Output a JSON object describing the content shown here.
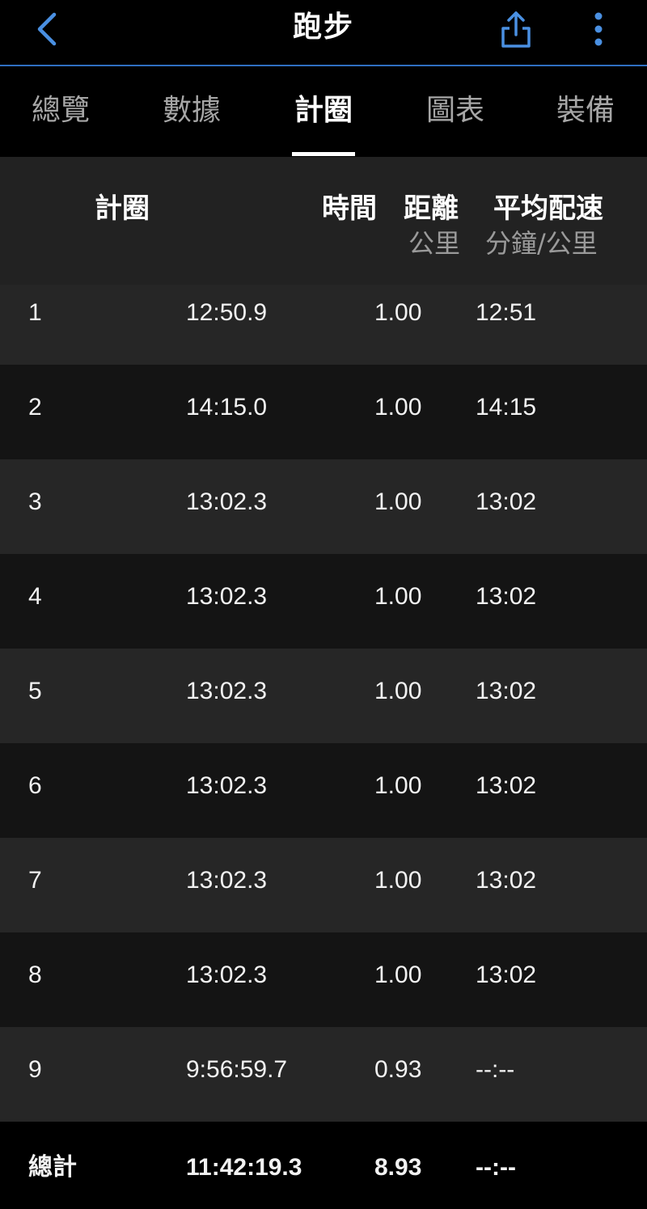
{
  "header": {
    "title": "跑步",
    "back_icon": "chevron-left-icon",
    "share_icon": "share-icon",
    "more_icon": "more-vertical-icon",
    "accent_color": "#4a90e2"
  },
  "tabs": [
    {
      "label": "總覽",
      "active": false
    },
    {
      "label": "數據",
      "active": false
    },
    {
      "label": "計圈",
      "active": true
    },
    {
      "label": "圖表",
      "active": false
    },
    {
      "label": "裝備",
      "active": false
    }
  ],
  "table": {
    "columns": {
      "lap": "計圈",
      "time": "時間",
      "distance": "距離",
      "distance_unit": "公里",
      "pace": "平均配速",
      "pace_unit": "分鐘/公里"
    },
    "rows": [
      {
        "lap": "1",
        "time": "12:50.9",
        "distance": "1.00",
        "pace": "12:51"
      },
      {
        "lap": "2",
        "time": "14:15.0",
        "distance": "1.00",
        "pace": "14:15"
      },
      {
        "lap": "3",
        "time": "13:02.3",
        "distance": "1.00",
        "pace": "13:02"
      },
      {
        "lap": "4",
        "time": "13:02.3",
        "distance": "1.00",
        "pace": "13:02"
      },
      {
        "lap": "5",
        "time": "13:02.3",
        "distance": "1.00",
        "pace": "13:02"
      },
      {
        "lap": "6",
        "time": "13:02.3",
        "distance": "1.00",
        "pace": "13:02"
      },
      {
        "lap": "7",
        "time": "13:02.3",
        "distance": "1.00",
        "pace": "13:02"
      },
      {
        "lap": "8",
        "time": "13:02.3",
        "distance": "1.00",
        "pace": "13:02"
      },
      {
        "lap": "9",
        "time": "9:56:59.7",
        "distance": "0.93",
        "pace": "--:--"
      }
    ],
    "total": {
      "lap": "總計",
      "time": "11:42:19.3",
      "distance": "8.93",
      "pace": "--:--"
    }
  }
}
